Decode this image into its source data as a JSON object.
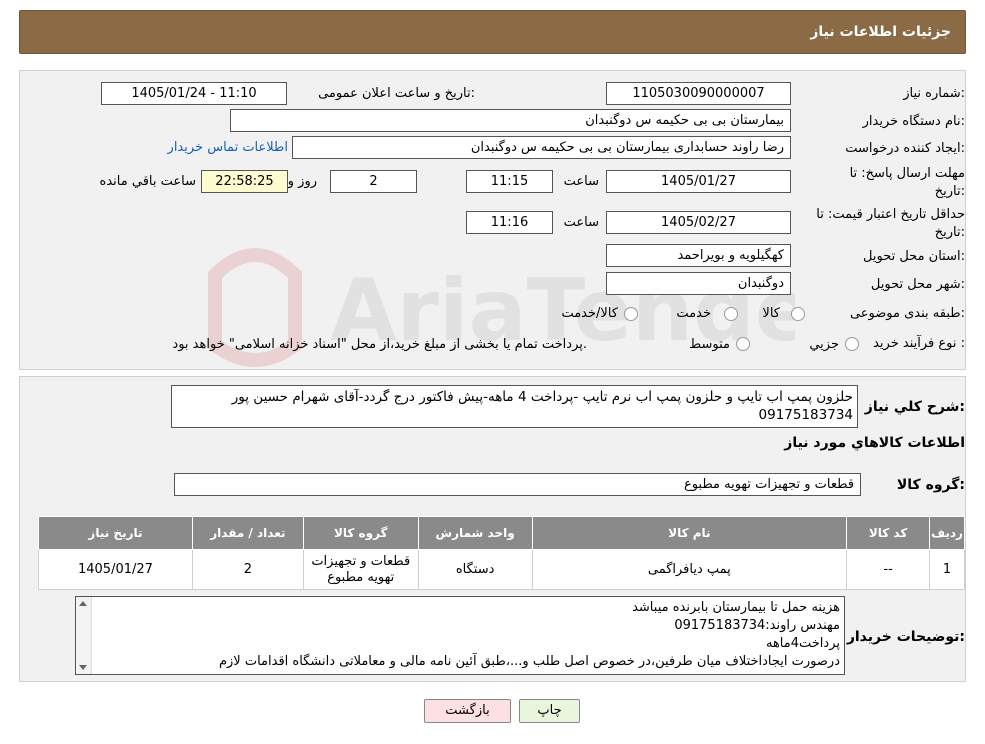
{
  "header": {
    "title": "جزئیات اطلاعات نیاز"
  },
  "form": {
    "need_number_label": "شماره نیاز:",
    "need_number": "1105030090000007",
    "announce_label": "تاریخ و ساعت اعلان عمومی:",
    "announce_value": "1405/01/24 - 11:10",
    "buyer_org_label": "نام دستگاه خریدار:",
    "buyer_org": "بیمارستان بی بی حکیمه س  دوگنبدان",
    "requester_label": "ایجاد کننده درخواست:",
    "requester": "رضا راوند حسابداری بیمارستان بی بی حکیمه س  دوگنبدان",
    "contact_link": "اطلاعات تماس خریدار",
    "deadline_label_1": "مهلت ارسال پاسخ: تا",
    "deadline_label_2": "تاریخ:",
    "deadline_date": "1405/01/27",
    "time_label": "ساعت",
    "deadline_time": "11:15",
    "days_value": "2",
    "days_label": "روز و",
    "remaining_time": "22:58:25",
    "remaining_label": "ساعت باقي مانده",
    "validity_label_1": "حداقل تاریخ اعتبار قیمت: تا",
    "validity_label_2": "تاریخ:",
    "validity_date": "1405/02/27",
    "validity_time": "11:16",
    "province_label": "استان محل تحویل:",
    "province": "کهگیلویه و بویراحمد",
    "city_label": "شهر محل تحویل:",
    "city": "دوگنبدان",
    "category_label": "طبقه بندی موضوعی:",
    "category_options": [
      "کالا",
      "خدمت",
      "کالا/خدمت"
    ],
    "process_label": "نوع فرآیند خرید :",
    "process_options": [
      "جزیي",
      "متوسط"
    ],
    "process_note": "پرداخت تمام یا بخشی از مبلغ خرید،از محل \"اسناد خزانه اسلامی\" خواهد بود."
  },
  "description": {
    "label": "شرح کلي نياز:",
    "text": "حلزون پمپ اب تایپ و حلزون پمپ اب نرم تایپ -پرداخت 4 ماهه-پیش فاکتور درج گردد-آقای شهرام حسین پور 09175183734"
  },
  "goods": {
    "title": "اطلاعات کالاهاي مورد نياز",
    "group_label": "گروه کالا:",
    "group_value": "قطعات و تجهیزات تهویه مطبوع"
  },
  "table": {
    "headers": [
      "ردیف",
      "کد کالا",
      "نام کالا",
      "واحد شمارش",
      "گروه کالا",
      "تعداد / مقدار",
      "تاریخ نیاز"
    ],
    "rows": [
      [
        "1",
        "--",
        "پمپ دیافراگمی",
        "دستگاه",
        "قطعات و تجهیزات تهویه مطبوع",
        "2",
        "1405/01/27"
      ]
    ]
  },
  "notes": {
    "label": "توضیحات خریدار:",
    "lines": [
      "هزینه حمل تا بیمارستان بابرنده میباشد",
      "مهندس راوند:09175183734",
      "پرداخت4ماهه",
      "درصورت ایجاداختلاف میان طرفین،در خصوص اصل طلب و...،طبق آئین نامه مالی و معاملاتی دانشگاه اقدامات لازم"
    ]
  },
  "buttons": {
    "print": "چاپ",
    "back": "بازگشت"
  },
  "watermark": {
    "text": "AriaTender.neT"
  },
  "colors": {
    "header": "#8a6b46",
    "table_header": "#8a8a8a",
    "print_btn": "#e8f7dc",
    "back_btn": "#fbe1e1"
  }
}
